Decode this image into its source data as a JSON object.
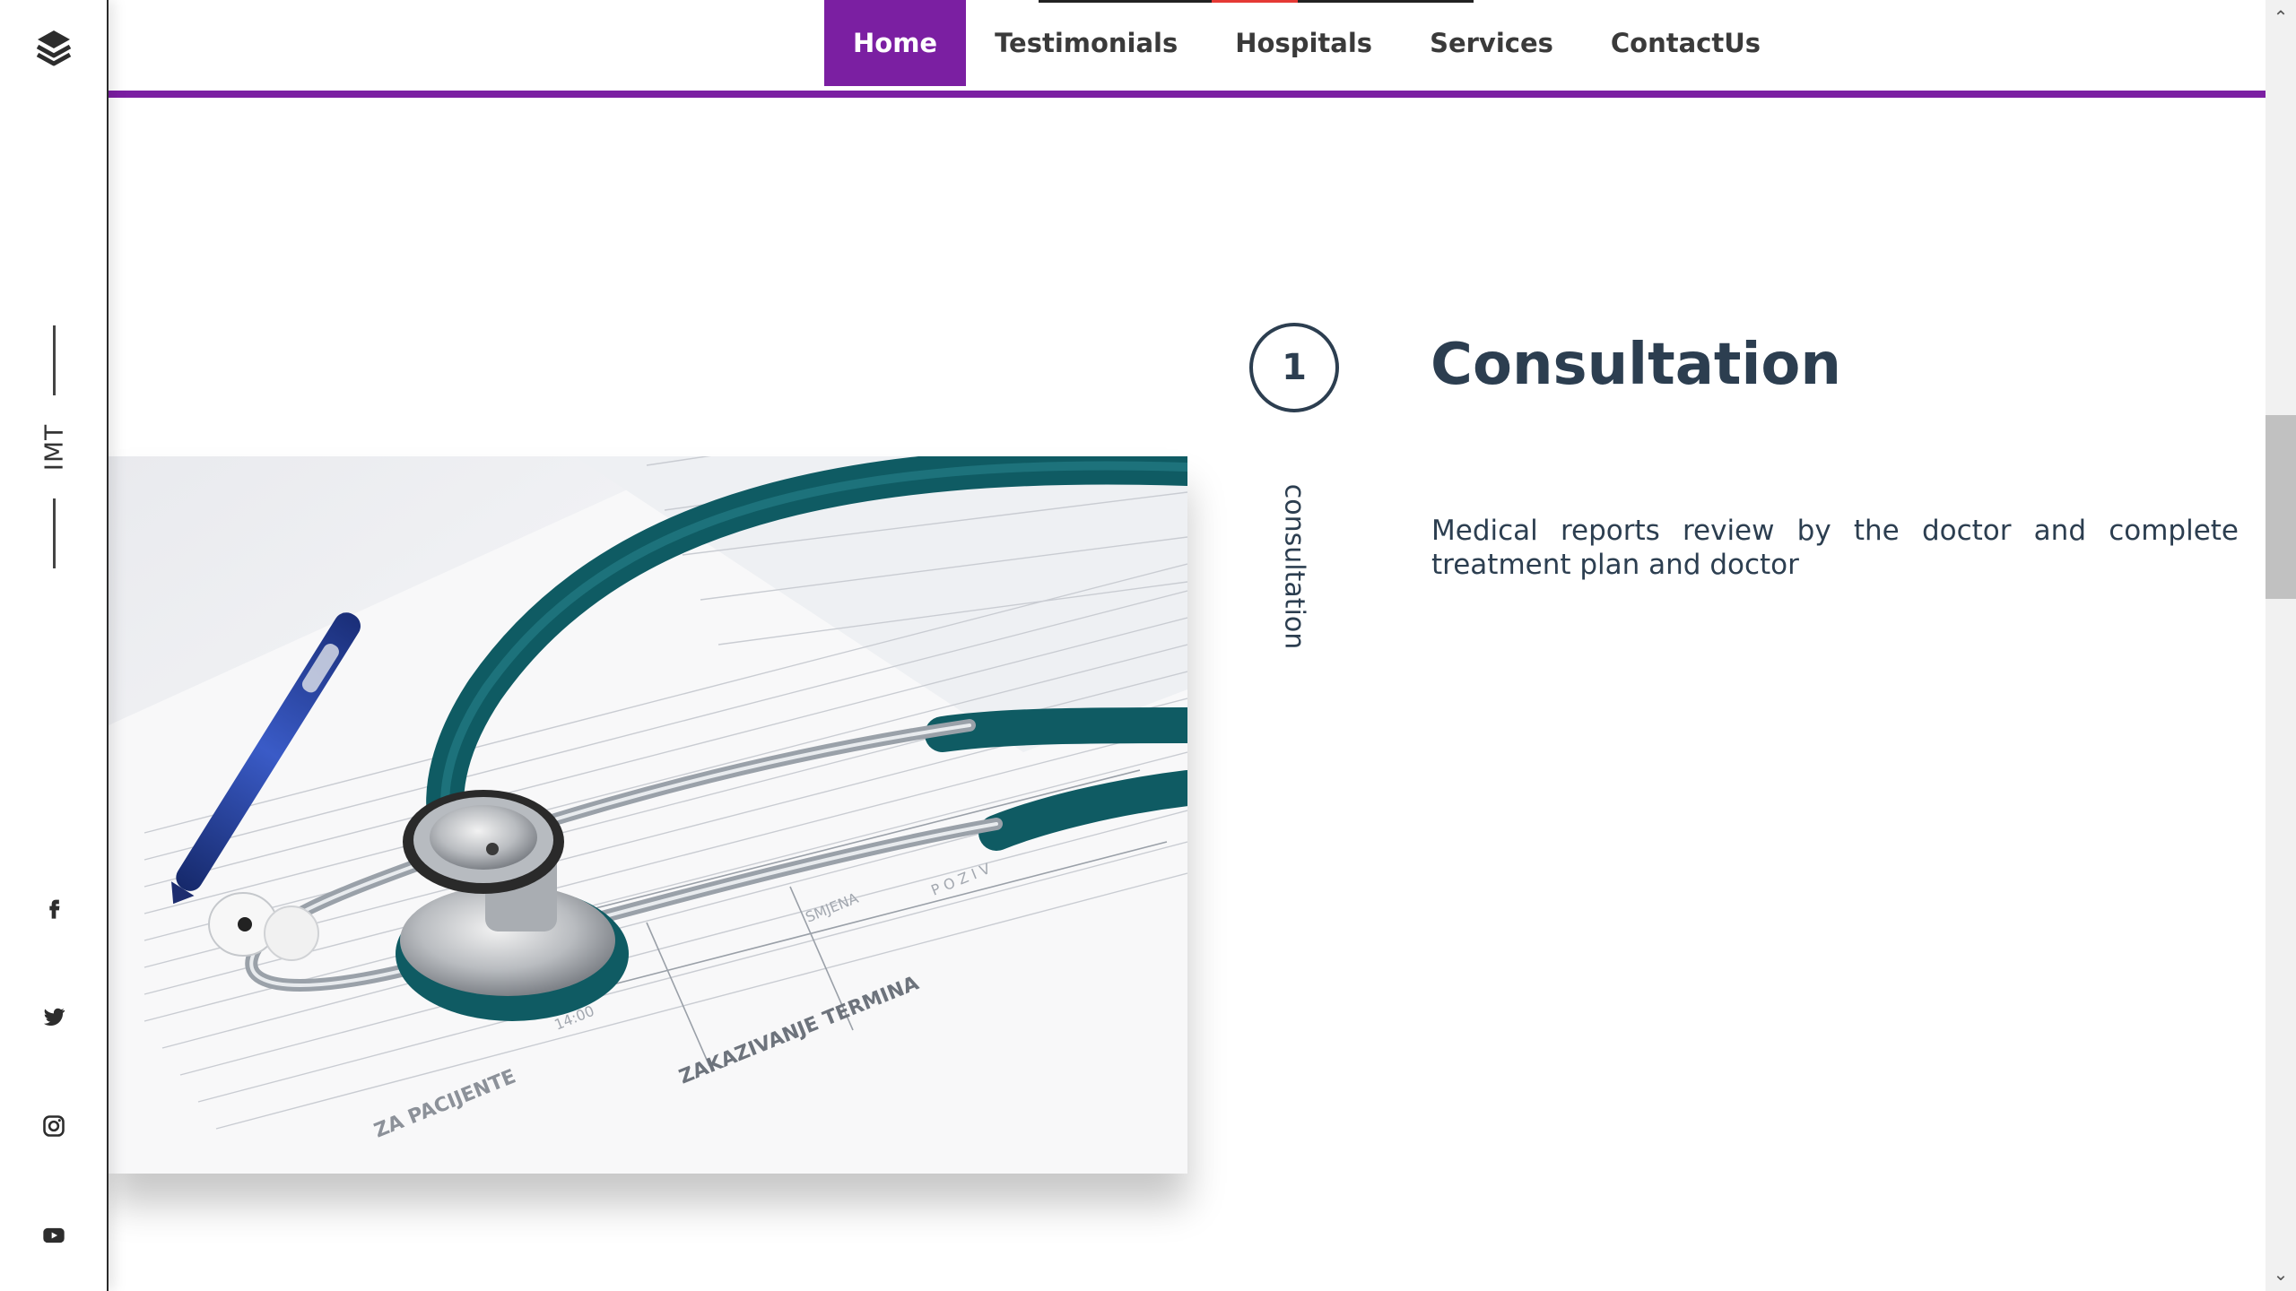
{
  "sidebar": {
    "brand": "IMT",
    "social": [
      {
        "name": "facebook-icon"
      },
      {
        "name": "twitter-icon"
      },
      {
        "name": "instagram-icon"
      },
      {
        "name": "youtube-icon"
      }
    ]
  },
  "nav": {
    "items": [
      {
        "label": "Home",
        "active": true
      },
      {
        "label": "Testimonials"
      },
      {
        "label": "Hospitals"
      },
      {
        "label": "Services"
      },
      {
        "label": "ContactUs"
      }
    ]
  },
  "step": {
    "number": "1",
    "vertical_label": "consultation",
    "title": "Consultation",
    "description": "Medical reports review by the doctor and complete treatment plan and doctor"
  },
  "colors": {
    "accent": "#7b1fa2",
    "text": "#2c3e50",
    "stethoscope": "#0f6a72"
  },
  "image": {
    "name": "stethoscope-on-medical-form-photo"
  }
}
